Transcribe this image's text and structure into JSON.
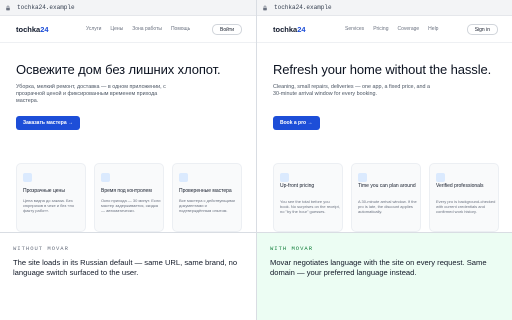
{
  "without": {
    "url": "tochka24.example",
    "brand": {
      "name": "tochka",
      "num": "24"
    },
    "nav": [
      "Услуги",
      "Цены",
      "Зона работы",
      "Помощь"
    ],
    "signin": "Войти",
    "hero_title": "Освежите дом без лишних хлопот.",
    "hero_sub": "Уборка, мелкий ремонт, доставка — в одном приложении, с прозрачной ценой и фиксированным временем прихода мастера.",
    "cta": "Заказать мастера →",
    "cards": [
      {
        "title": "Прозрачные цены",
        "text": "Цена видна до заказа. Без сюрпризов в чеке и без «по факту работ»."
      },
      {
        "title": "Время под контролем",
        "text": "Окно прихода — 30 минут. Если мастер задерживается, скидка — автоматически."
      },
      {
        "title": "Проверенные мастера",
        "text": "Все мастера с действующими документами и подтверждённым опытом."
      }
    ]
  },
  "with": {
    "url": "tochka24.example",
    "brand": {
      "name": "tochka",
      "num": "24"
    },
    "nav": [
      "Services",
      "Pricing",
      "Coverage",
      "Help"
    ],
    "signin": "Sign in",
    "hero_title": "Refresh your home without the hassle.",
    "hero_sub": "Cleaning, small repairs, deliveries — one app, a fixed price, and a 30-minute arrival window for every booking.",
    "cta": "Book a pro →",
    "cards": [
      {
        "title": "Up-front pricing",
        "text": "You see the total before you book. No surprises on the receipt, no \"by the hour\" guesses."
      },
      {
        "title": "Time you can plan around",
        "text": "A 30-minute arrival window. If the pro is late, the discount applies automatically."
      },
      {
        "title": "Verified professionals",
        "text": "Every pro is background-checked with current credentials and confirmed work history."
      }
    ]
  },
  "captions": {
    "left_label": "WITHOUT MOVAR",
    "left_text": "The site loads in its Russian default — same URL, same brand, no language switch surfaced to the user.",
    "right_label": "WITH MOVAR",
    "right_text": "Movar negotiates language with the site on every request. Same domain — your preferred language instead."
  },
  "colors": {
    "accent": "#1d4ed8",
    "with_bg": "#ecfdf3",
    "with_label": "#15803d"
  }
}
